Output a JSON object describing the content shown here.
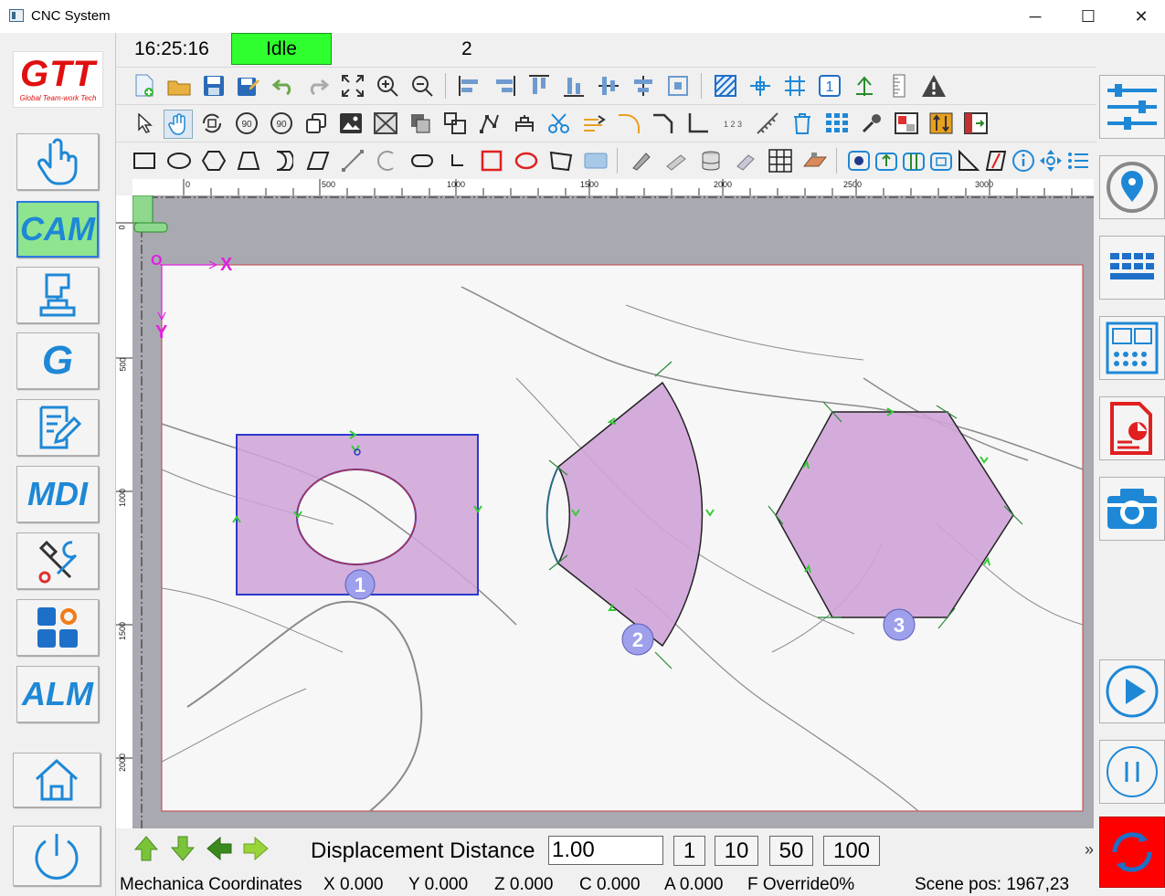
{
  "window": {
    "title": "CNC System",
    "minimize": "─",
    "maximize": "☐",
    "close": "✕"
  },
  "logo": {
    "text": "GTT",
    "tagline": "Global Team-work Tech"
  },
  "status": {
    "time": "16:25:16",
    "state": "Idle",
    "counter": "2",
    "state_color": "#2fff2f"
  },
  "sidebar": {
    "items": [
      {
        "name": "touch",
        "label": ""
      },
      {
        "name": "cam",
        "label": "CAM",
        "active": true
      },
      {
        "name": "machine",
        "label": ""
      },
      {
        "name": "gcode",
        "label": "G"
      },
      {
        "name": "edit",
        "label": ""
      },
      {
        "name": "mdi",
        "label": "MDI"
      },
      {
        "name": "tools",
        "label": ""
      },
      {
        "name": "apps",
        "label": ""
      },
      {
        "name": "alarm",
        "label": "ALM"
      },
      {
        "name": "home",
        "label": ""
      },
      {
        "name": "power",
        "label": ""
      }
    ]
  },
  "ruler": {
    "h_ticks": [
      "0",
      "500",
      "1000",
      "1500",
      "2000",
      "2500",
      "3000"
    ],
    "v_ticks": [
      "0",
      "500",
      "1000",
      "1500",
      "2000"
    ]
  },
  "canvas": {
    "origin_label": "O",
    "x_axis_label": "X",
    "y_axis_label": "Y",
    "parts": [
      {
        "number": "1",
        "shape": "rectangle-with-ellipse-hole"
      },
      {
        "number": "2",
        "shape": "annular-sector"
      },
      {
        "number": "3",
        "shape": "hexagon"
      }
    ]
  },
  "bottom": {
    "displacement_label": "Displacement Distance",
    "displacement_value": "1.00",
    "steps": [
      "1",
      "10",
      "50",
      "100"
    ],
    "more": "»"
  },
  "coords": {
    "title": "Mechanica Coordinates",
    "x": "X 0.000",
    "y": "Y 0.000",
    "z": "Z 0.000",
    "c": "C 0.000",
    "a": "A 0.000",
    "f": "F Override0%",
    "scene": "Scene pos: 1967,23"
  },
  "colors": {
    "accent": "#1e88d6",
    "part_fill": "#cfa3d8",
    "run_bg": "#ff0000",
    "arrow_green": "#33cc33"
  }
}
